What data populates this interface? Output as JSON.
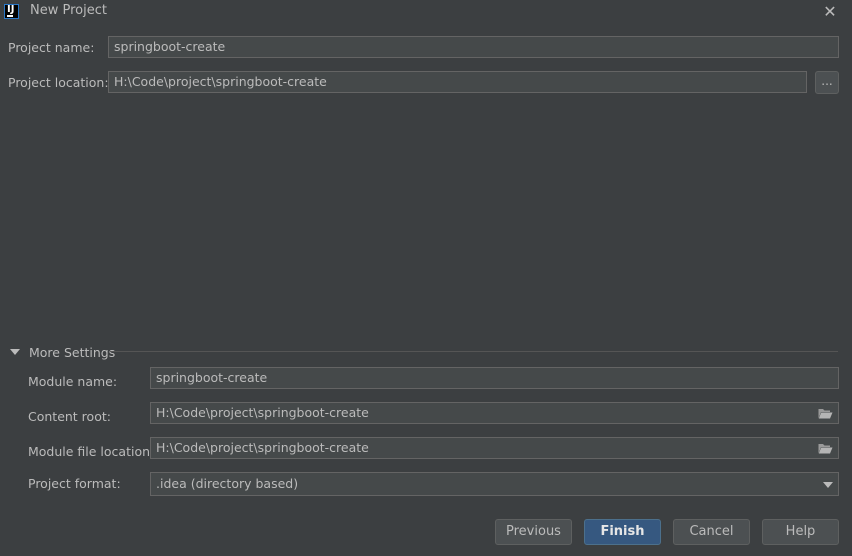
{
  "window": {
    "title": "New Project",
    "close_glyph": "✕",
    "app_icon": "intellij-idea-icon"
  },
  "project": {
    "name_label": "Project name:",
    "name_value": "springboot-create",
    "location_label": "Project location:",
    "location_value": "H:\\Code\\project\\springboot-create",
    "browse_label": "..."
  },
  "more_settings": {
    "header": "More Settings",
    "expanded": true,
    "module_name_label": "Module name:",
    "module_name_value": "springboot-create",
    "content_root_label": "Content root:",
    "content_root_value": "H:\\Code\\project\\springboot-create",
    "module_file_label": "Module file location:",
    "module_file_value": "H:\\Code\\project\\springboot-create",
    "format_label": "Project format:",
    "format_value": ".idea (directory based)"
  },
  "buttons": {
    "previous": "Previous",
    "finish": "Finish",
    "cancel": "Cancel",
    "help": "Help"
  },
  "colors": {
    "background": "#3c3f41",
    "field_background": "#45494a",
    "primary_button": "#365880",
    "text": "#bbbbbb"
  }
}
